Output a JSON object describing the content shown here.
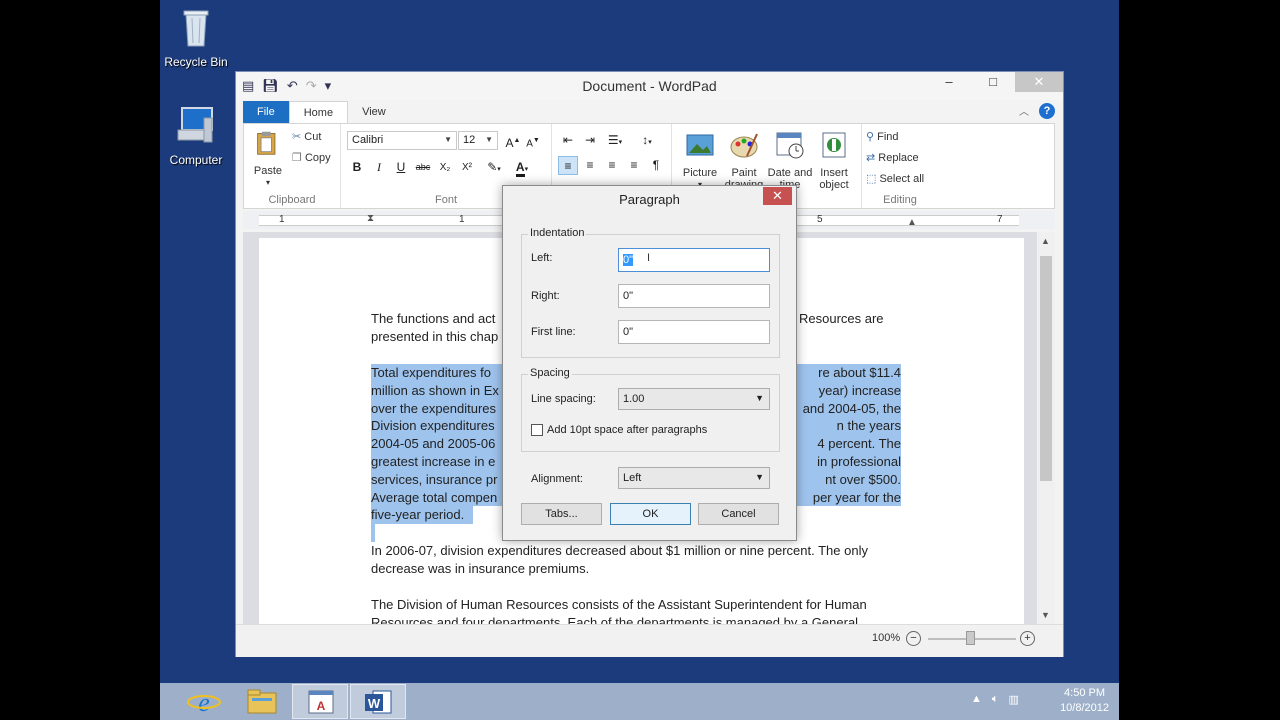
{
  "desktop": {
    "icons": [
      {
        "label": "Recycle Bin"
      },
      {
        "label": "Computer"
      }
    ]
  },
  "window": {
    "title": "Document - WordPad",
    "tabs": [
      "File",
      "Home",
      "View"
    ],
    "ribbon": {
      "clipboard": {
        "paste": "Paste",
        "cut": "Cut",
        "copy": "Copy",
        "label": "Clipboard"
      },
      "font": {
        "family": "Calibri",
        "size": "12",
        "label": "Font",
        "bold": "B",
        "italic": "I",
        "underline": "U",
        "strike": "abc",
        "sub": "X₂",
        "sup": "X²"
      },
      "insert": {
        "picture": "Picture",
        "paint_drawing_1": "Paint",
        "paint_drawing_2": "drawing",
        "datetime_1": "Date and",
        "datetime_2": "time",
        "insert_object_1": "Insert",
        "insert_object_2": "object"
      },
      "editing": {
        "find": "Find",
        "replace": "Replace",
        "select_all": "Select all",
        "label": "Editing"
      }
    },
    "ruler": {
      "numbers": [
        "1",
        "1",
        "5",
        "7"
      ]
    },
    "document": {
      "para1_line1_a": "The functions and act",
      "para1_line1_b": "Resources are",
      "para1_line2": "presented in this chap",
      "sel_lines": [
        {
          "a": "Total expenditures fo",
          "b": "re about $11.4"
        },
        {
          "a": "million as shown in Ex",
          "b": "year) increase"
        },
        {
          "a": "over the expenditures",
          "b": "and 2004-05, the"
        },
        {
          "a": "Division expenditures",
          "b": "n the years"
        },
        {
          "a": "2004-05 and 2005-06",
          "b": "4 percent.  The"
        },
        {
          "a": "greatest increase in e",
          "b": "in professional"
        },
        {
          "a": "services, insurance pr",
          "b": "nt over $500."
        },
        {
          "a": "Average total compen",
          "b": "per year for the"
        },
        {
          "a": "five-year period.",
          "b": ""
        }
      ],
      "para3_line1": "In 2006-07, division expenditures decreased about $1 million or nine percent.  The only",
      "para3_line2": "decrease was in insurance premiums.",
      "para4_line1": "The Division of Human Resources consists of the Assistant Superintendent for Human",
      "para4_line2": "Resources and four departments.  Each of the departments is managed by a General"
    },
    "status": {
      "zoom": "100%"
    }
  },
  "dialog": {
    "title": "Paragraph",
    "indentation_label": "Indentation",
    "left_label": "Left:",
    "left_value": "0\"",
    "right_label": "Right:",
    "right_value": "0\"",
    "first_line_label": "First line:",
    "first_line_value": "0\"",
    "spacing_label": "Spacing",
    "line_spacing_label": "Line spacing:",
    "line_spacing_value": "1.00",
    "add_space_label": "Add 10pt space after paragraphs",
    "alignment_label": "Alignment:",
    "alignment_value": "Left",
    "tabs_button": "Tabs...",
    "ok_button": "OK",
    "cancel_button": "Cancel"
  },
  "taskbar": {
    "time": "4:50 PM",
    "date": "10/8/2012"
  },
  "colors": {
    "desktop": "#1b3b7c",
    "file_tab": "#1c6fc2",
    "selection": "#9ec4ee",
    "close_red": "#c75050"
  }
}
